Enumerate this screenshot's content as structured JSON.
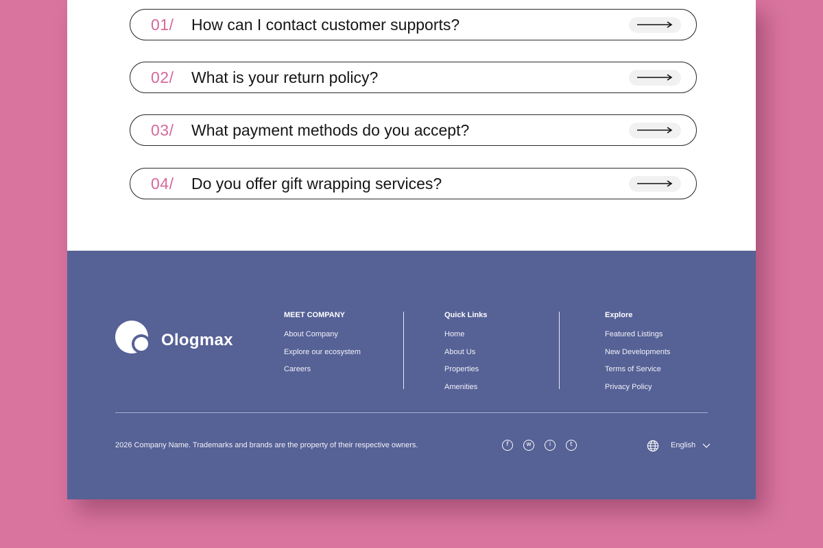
{
  "faq": [
    {
      "num": "01/",
      "question": "How can I contact customer supports?"
    },
    {
      "num": "02/",
      "question": "What is your return policy?"
    },
    {
      "num": "03/",
      "question": "What payment methods do you accept?"
    },
    {
      "num": "04/",
      "question": "Do you offer gift wrapping services?"
    }
  ],
  "brand": {
    "name": "Ologmax"
  },
  "footer": {
    "columns": [
      {
        "title": "MEET COMPANY",
        "links": [
          "About Company",
          "Explore our ecosystem",
          "Careers"
        ]
      },
      {
        "title": "Quick Links",
        "links": [
          "Home",
          "About Us",
          "Properties",
          "Amenities"
        ]
      },
      {
        "title": "Explore",
        "links": [
          "Featured Listings",
          "New Developments",
          "Terms of Service",
          "Privacy Policy"
        ]
      }
    ],
    "copyright": "2026 Company Name. Trademarks and brands are the property of their respective owners.",
    "social": [
      {
        "name": "facebook-icon",
        "glyph": "f"
      },
      {
        "name": "wordpress-icon",
        "glyph": "w"
      },
      {
        "name": "info-icon",
        "glyph": "i"
      },
      {
        "name": "tumblr-icon",
        "glyph": "t"
      }
    ],
    "language": "English"
  },
  "colors": {
    "accent": "#d6689a",
    "footer_bg": "#566196",
    "backdrop": "#d9749f"
  }
}
